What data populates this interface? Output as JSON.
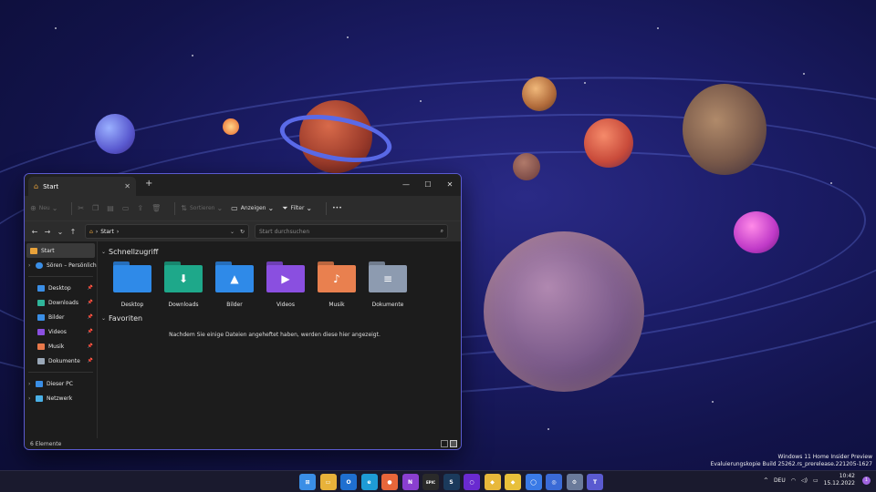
{
  "explorer": {
    "tab_title": "Start",
    "new_tab": "+",
    "window_controls": {
      "minimize": "—",
      "maximize": "☐",
      "close": "✕"
    },
    "toolbar": {
      "new": "Neu",
      "sort": "Sortieren",
      "view": "Anzeigen",
      "filter": "Filter",
      "more": "•••"
    },
    "address": {
      "crumb": "Start",
      "search_placeholder": "Start durchsuchen"
    },
    "sidebar": {
      "start": "Start",
      "onedrive": "Sören – Persönlich",
      "pinned": [
        {
          "label": "Desktop",
          "color": "#3a8ee6"
        },
        {
          "label": "Downloads",
          "color": "#2fb59a"
        },
        {
          "label": "Bilder",
          "color": "#3a8ee6"
        },
        {
          "label": "Videos",
          "color": "#8a4fe0"
        },
        {
          "label": "Musik",
          "color": "#e8784a"
        },
        {
          "label": "Dokumente",
          "color": "#9aa8b8"
        }
      ],
      "this_pc": "Dieser PC",
      "network": "Netzwerk"
    },
    "quick_access": {
      "heading": "Schnellzugriff",
      "folders": [
        {
          "label": "Desktop",
          "color": "#2f8ae8",
          "glyph": ""
        },
        {
          "label": "Downloads",
          "color": "#1ea88a",
          "glyph": "⬇"
        },
        {
          "label": "Bilder",
          "color": "#2f8ae8",
          "glyph": "▲"
        },
        {
          "label": "Videos",
          "color": "#8a4fe0",
          "glyph": "▶"
        },
        {
          "label": "Musik",
          "color": "#e9804f",
          "glyph": "♪"
        },
        {
          "label": "Dokumente",
          "color": "#8d9bb0",
          "glyph": "≡"
        }
      ]
    },
    "favorites": {
      "heading": "Favoriten",
      "empty_text": "Nachdem Sie einige Dateien angeheftet haben, werden diese hier angezeigt."
    },
    "status": "6 Elemente"
  },
  "watermark": {
    "line1": "Windows 11 Home Insider Preview",
    "line2": "Evaluierungskopie Build 25262.rs_prerelease.221205-1627"
  },
  "taskbar": {
    "apps": [
      {
        "name": "start",
        "color": "#3a8ee6",
        "text": "⊞"
      },
      {
        "name": "file-explorer",
        "color": "#e8b23a",
        "text": "▭"
      },
      {
        "name": "outlook",
        "color": "#1f6fd0",
        "text": "O"
      },
      {
        "name": "edge",
        "color": "#1e9bd6",
        "text": "e"
      },
      {
        "name": "firefox",
        "color": "#e8663a",
        "text": "●"
      },
      {
        "name": "onenote",
        "color": "#8a3fd0",
        "text": "N"
      },
      {
        "name": "epic",
        "color": "#2a2a2a",
        "text": "EPIC"
      },
      {
        "name": "steam",
        "color": "#1b3a5c",
        "text": "S"
      },
      {
        "name": "app-ring",
        "color": "#6a2ad0",
        "text": "○"
      },
      {
        "name": "app-yellow",
        "color": "#e8b83a",
        "text": "◆"
      },
      {
        "name": "app-yellow-2",
        "color": "#e8c03a",
        "text": "◆"
      },
      {
        "name": "chat",
        "color": "#3a7ae6",
        "text": "◯"
      },
      {
        "name": "app-blue",
        "color": "#3a6ad6",
        "text": "◎"
      },
      {
        "name": "settings",
        "color": "#6a7a9a",
        "text": "⚙"
      },
      {
        "name": "teams",
        "color": "#5a5ad0",
        "text": "T"
      }
    ],
    "tray": {
      "chevron": "^",
      "lang": "DEU",
      "time": "10:42",
      "date": "15.12.2022",
      "notifications": "1"
    }
  }
}
